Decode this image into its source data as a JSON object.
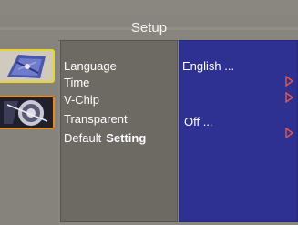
{
  "header": {
    "title": "Setup"
  },
  "menu": {
    "items": [
      {
        "label": "Language"
      },
      {
        "label": "Time"
      },
      {
        "label": "V-Chip"
      },
      {
        "label": "Transparent"
      },
      {
        "label": "Default",
        "bold_label": "Setting"
      }
    ]
  },
  "values": {
    "language": "English ...",
    "transparent": "Off ..."
  },
  "icons": {
    "submenu_arrow": "triangle-right-outline-icon",
    "thumbnail_1": "picture-thumbnail-icon",
    "thumbnail_2": "picture-thumbnail-icon"
  },
  "colors": {
    "background": "#8a8680",
    "menu_panel": "#6d6a64",
    "value_panel": "#2f3192",
    "arrow": "#e2574c",
    "thumb_border_1": "#e9d52a",
    "thumb_border_2": "#e88a1c",
    "text": "#ffffff"
  }
}
